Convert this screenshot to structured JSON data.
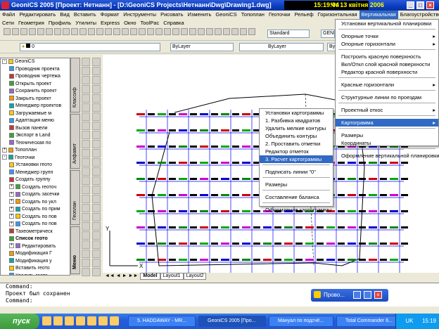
{
  "window": {
    "title": "GeoniCS 2005 [Проект: Нетнанн] - [D:\\GeoniCS Projects\\Нетнанн\\Dwg\\Drawing1.dwg]",
    "clock": "15:19:04",
    "date": "Чт 13 квітня 2006"
  },
  "menubar": [
    "Файл",
    "Редактировать",
    "Вид",
    "Вставить",
    "Формат",
    "Инструменты",
    "Рисовать",
    "Изменить",
    "GeoniCS",
    "Топоплан",
    "Геоточки",
    "Рельеф",
    "Горизонтальная",
    "Вертикальная",
    "Благоустройство"
  ],
  "menubar_active": "Вертикальная",
  "menubar2": [
    "Сети",
    "Геометрия",
    "Профиль",
    "Утилиты",
    "Express",
    "Окно",
    "ToolPac",
    "Справка"
  ],
  "toolbar": {
    "layer_value": "0",
    "style_value": "Standard",
    "style2_value": "GENI",
    "color_value": "ByLayer",
    "linetype_value": "ByLayer",
    "lineweight_value": "By"
  },
  "tree": {
    "items": [
      {
        "label": "GeoniCS",
        "indent": 0,
        "pm": "-"
      },
      {
        "label": "Проводник проекта",
        "indent": 1
      },
      {
        "label": "Проводник чертежа",
        "indent": 1
      },
      {
        "label": "Открыть проект",
        "indent": 1
      },
      {
        "label": "Сохранить проект",
        "indent": 1
      },
      {
        "label": "Закрыть проект",
        "indent": 1
      },
      {
        "label": "Менеджер проектов",
        "indent": 1
      },
      {
        "label": "Загружаемые м",
        "indent": 1
      },
      {
        "label": "Адаптация меню",
        "indent": 1
      },
      {
        "label": "Вызов панели",
        "indent": 1
      },
      {
        "label": "Экспорт в Land",
        "indent": 1
      },
      {
        "label": "Техническая по",
        "indent": 1
      },
      {
        "label": "Топоплан",
        "indent": 0,
        "pm": "+"
      },
      {
        "label": "Геоточки",
        "indent": 0,
        "pm": "-"
      },
      {
        "label": "Установки геото",
        "indent": 1
      },
      {
        "label": "Менеджер групп",
        "indent": 1
      },
      {
        "label": "Создать группу",
        "indent": 1
      },
      {
        "label": "Создать геоточ",
        "indent": 1,
        "pm": "+"
      },
      {
        "label": "Создать засечки",
        "indent": 1,
        "pm": "+"
      },
      {
        "label": "Создать по укл",
        "indent": 1,
        "pm": "+"
      },
      {
        "label": "Создать по прим",
        "indent": 1,
        "pm": "+"
      },
      {
        "label": "Создать по пов",
        "indent": 1,
        "pm": "+"
      },
      {
        "label": "Создать по пов",
        "indent": 1,
        "pm": "+"
      },
      {
        "label": "Тахеометрическ",
        "indent": 1
      },
      {
        "label": "Список геото",
        "indent": 1,
        "bold": true
      },
      {
        "label": "Редактировать",
        "indent": 1,
        "pm": "+"
      },
      {
        "label": "Модификация Г",
        "indent": 1
      },
      {
        "label": "Модификация у",
        "indent": 1
      },
      {
        "label": "Вставить геото",
        "indent": 1
      },
      {
        "label": "Удалить геото",
        "indent": 1
      },
      {
        "label": "Импорт-экспор",
        "indent": 1,
        "pm": "+"
      },
      {
        "label": "Утилиты для ге",
        "indent": 1,
        "pm": "+"
      }
    ]
  },
  "sidetabs": [
    "Классиф",
    "Алфавит",
    "Геоплан",
    "Меню"
  ],
  "layout_tabs": [
    "Model",
    "Layout1",
    "Layout2"
  ],
  "command": {
    "line1": "Command:",
    "line2": "Проект был сохранен",
    "line3": "Command:"
  },
  "floating_panel": {
    "label": "Прово..."
  },
  "vertical_menu": {
    "items": [
      {
        "label": "Установки вертикальной планировки",
        "type": "item"
      },
      {
        "type": "sep"
      },
      {
        "label": "Опорные точки",
        "type": "item",
        "submenu": true
      },
      {
        "label": "Опорные горизонтали",
        "type": "item",
        "submenu": true
      },
      {
        "type": "sep"
      },
      {
        "label": "Построить красную поверхность",
        "type": "item"
      },
      {
        "label": "Вкл/Откл слой красной поверхности",
        "type": "item"
      },
      {
        "label": "Редактор красной поверхности",
        "type": "item"
      },
      {
        "type": "sep"
      },
      {
        "label": "Красные горизонтали",
        "type": "item",
        "submenu": true
      },
      {
        "type": "sep"
      },
      {
        "label": "Структурные линии по проездам",
        "type": "item"
      },
      {
        "type": "sep"
      },
      {
        "label": "Проектный откос",
        "type": "item",
        "submenu": true
      },
      {
        "type": "sep"
      },
      {
        "label": "Картограмма",
        "type": "item",
        "submenu": true,
        "active": true
      },
      {
        "type": "sep"
      },
      {
        "label": "Размеры",
        "type": "item"
      },
      {
        "label": "Координаты",
        "type": "item"
      },
      {
        "type": "sep"
      },
      {
        "label": "Оформление вертикальной планировки",
        "type": "item"
      }
    ]
  },
  "kartogramma_menu": {
    "items": [
      {
        "label": "Установки картограммы",
        "type": "item"
      },
      {
        "label": "1. Разбивка квадратов",
        "type": "item"
      },
      {
        "label": "Удалить мелкие контуры",
        "type": "item"
      },
      {
        "label": "Объединить контуры",
        "type": "item"
      },
      {
        "label": "2. Проставить отметки",
        "type": "item"
      },
      {
        "label": "Редактор отметок",
        "type": "item"
      },
      {
        "label": "3. Расчет картограммы",
        "type": "item",
        "active": true
      },
      {
        "type": "sep"
      },
      {
        "label": "Подписать линии \"0\"",
        "type": "item"
      },
      {
        "type": "sep"
      },
      {
        "label": "Размеры",
        "type": "item"
      },
      {
        "type": "sep"
      },
      {
        "label": "Составление баланса",
        "type": "item"
      },
      {
        "type": "sep"
      },
      {
        "label": "Оформление картограммы",
        "type": "item"
      }
    ]
  },
  "taskbar": {
    "start": "пуск",
    "tasks": [
      {
        "label": "5. HADDAWAY - MR..."
      },
      {
        "label": "GeoniCS 2005 [Про...",
        "active": true
      },
      {
        "label": "Мануал по подсчё..."
      },
      {
        "label": "Total Commander 6..."
      }
    ],
    "tray_lang": "UK",
    "tray_time": "15:19"
  },
  "colors": {
    "accent": "#316ac5",
    "title": "#0a3cbf",
    "drawing_grid": "#0000ff",
    "contour": "#000000"
  }
}
